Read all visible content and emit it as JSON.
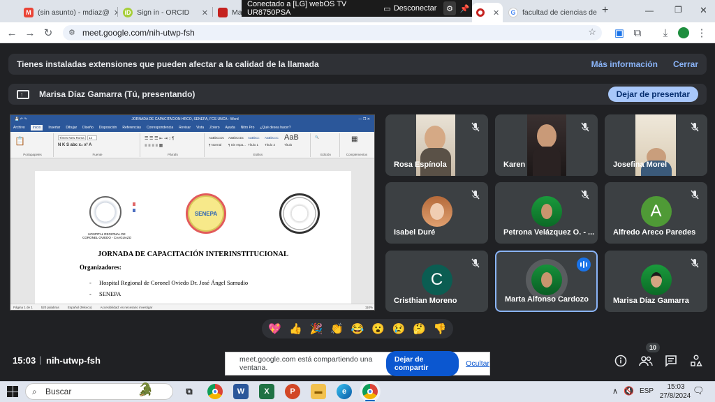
{
  "browser": {
    "tabs": [
      {
        "title": "(sin asunto) - mdiaz@",
        "icon": "gmail-icon",
        "color": "#ea4335"
      },
      {
        "title": "Sign in - ORCID",
        "icon": "orcid-icon",
        "color": "#a6ce39"
      },
      {
        "title": "Mar",
        "icon": "page-icon",
        "color": "#c5221f"
      },
      {
        "title": "",
        "icon": "meet-record-icon",
        "color": "#c5221f"
      },
      {
        "title": "facultad de ciencias de",
        "icon": "google-icon",
        "color": "#4285f4"
      }
    ],
    "cast_banner": {
      "text": "Conectado a [LG] webOS TV UR8750PSA",
      "disconnect": "Desconectar"
    },
    "url": "meet.google.com/nih-utwp-fsh"
  },
  "meet": {
    "warning": {
      "text": "Tienes instaladas extensiones que pueden afectar a la calidad de la llamada",
      "more_info": "Más información",
      "close": "Cerrar"
    },
    "presenting": {
      "text": "Marisa Díaz Gamarra (Tú, presentando)",
      "stop_button": "Dejar de presentar"
    },
    "shared_doc": {
      "window_title": "JORNADA DE CAPACITACION HRCO, SENEPA, FCS UNCA - Word",
      "menu": [
        "Archivo",
        "Inicio",
        "Insertar",
        "Dibujar",
        "Diseño",
        "Disposición",
        "Referencias",
        "Correspondencia",
        "Revisar",
        "Vista",
        "Zotero",
        "Ayuda",
        "Nitro Pro",
        "¿Qué desea hacer?"
      ],
      "font_name": "Times New Roma",
      "font_size": "12",
      "ribbon_groups": [
        "Portapapeles",
        "Fuente",
        "Párrafo",
        "Estilos",
        "Edición",
        "Complementos"
      ],
      "styles": [
        "AaBbCcDc",
        "AaBbCcDc",
        "AaBbCc",
        "AaBbCcC",
        "AaB"
      ],
      "style_names": [
        "¶ Normal",
        "¶ Sin espa...",
        "Título 1",
        "Título 2",
        "Título"
      ],
      "logo_left_caption": "HOSPITAL REGIONAL DE CORONEL OVIEDO - CAAGUAZÚ",
      "logo_center_text": "SENEPA",
      "heading": "JORNADA DE CAPACITACIÓN INTERINSTITUCIONAL",
      "subheading": "Organizadores:",
      "bullets": [
        "Hospital Regional de Coronel Oviedo Dr. José Ángel Samudio",
        "SENEPA"
      ],
      "status": [
        "Página 1 de 1",
        "520 palabras",
        "Español (México)",
        "Accesibilidad: es necesario investigar"
      ],
      "zoom": "110%"
    },
    "participants": [
      {
        "name": "Rosa Espínola",
        "type": "video",
        "muted": true
      },
      {
        "name": "Karen",
        "type": "video",
        "muted": true
      },
      {
        "name": "Josefina Morel",
        "type": "video",
        "muted": true
      },
      {
        "name": "Isabel Duré",
        "type": "photo",
        "muted": true
      },
      {
        "name": "Petrona Velázquez O. - ...",
        "type": "photo",
        "muted": true
      },
      {
        "name": "Alfredo Areco Paredes",
        "type": "letter",
        "letter": "A",
        "color": "#4f9a36",
        "muted": true
      },
      {
        "name": "Cristhian Moreno",
        "type": "letter",
        "letter": "C",
        "color": "#0b5d52",
        "muted": true
      },
      {
        "name": "Marta Alfonso Cardozo",
        "type": "photo",
        "muted": false,
        "speaking": true
      },
      {
        "name": "Marisa Díaz Gamarra",
        "type": "photo",
        "muted": true
      }
    ],
    "reactions": [
      "💖",
      "👍",
      "🎉",
      "👏",
      "😂",
      "😮",
      "😢",
      "🤔",
      "👎"
    ],
    "bottom": {
      "time": "15:03",
      "meeting_code": "nih-utwp-fsh",
      "participant_count": "10"
    },
    "share_notice": {
      "text": "meet.google.com está compartiendo una ventana.",
      "stop": "Dejar de compartir",
      "hide": "Ocultar"
    }
  },
  "taskbar": {
    "search_placeholder": "Buscar",
    "apps": [
      "task-view-icon",
      "chrome-icon",
      "word-icon",
      "excel-icon",
      "powerpoint-icon",
      "file-explorer-icon",
      "edge-icon",
      "chrome-active-icon"
    ],
    "language": "ESP",
    "time": "15:03",
    "date": "27/8/2024"
  }
}
